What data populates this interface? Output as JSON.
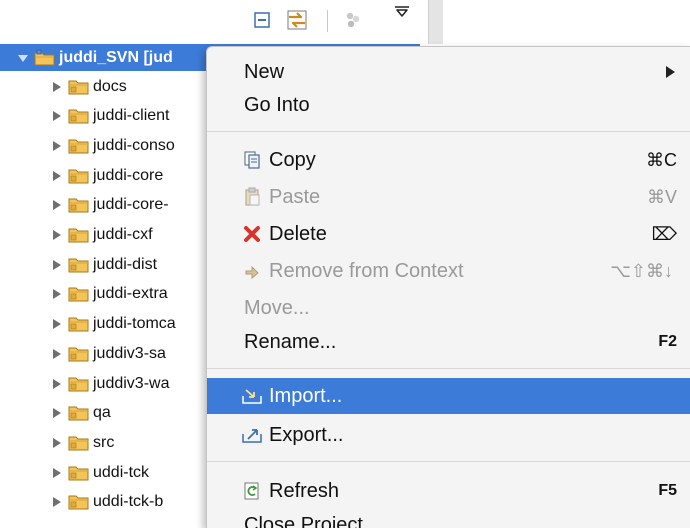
{
  "tree": {
    "root_label": "juddi_SVN [jud",
    "items": [
      {
        "label": "docs"
      },
      {
        "label": "juddi-client"
      },
      {
        "label": "juddi-conso"
      },
      {
        "label": "juddi-core"
      },
      {
        "label": "juddi-core-"
      },
      {
        "label": "juddi-cxf"
      },
      {
        "label": "juddi-dist"
      },
      {
        "label": "juddi-extra"
      },
      {
        "label": "juddi-tomca"
      },
      {
        "label": "juddiv3-sa"
      },
      {
        "label": "juddiv3-wa"
      },
      {
        "label": "qa"
      },
      {
        "label": "src"
      },
      {
        "label": "uddi-tck"
      },
      {
        "label": "uddi-tck-b"
      }
    ]
  },
  "menu": {
    "new": "New",
    "go_into": "Go Into",
    "copy": "Copy",
    "copy_accel": "⌘C",
    "paste": "Paste",
    "paste_accel": "⌘V",
    "delete": "Delete",
    "delete_accel": "⌦",
    "remove_context": "Remove from Context",
    "remove_context_accel": "⌥⇧⌘↓",
    "move": "Move...",
    "rename": "Rename...",
    "rename_accel": "F2",
    "import": "Import...",
    "export": "Export...",
    "refresh": "Refresh",
    "refresh_accel": "F5",
    "close_project": "Close Project"
  },
  "colors": {
    "selection": "#3d7bd8",
    "menu_bg": "#f4f4f4",
    "disabled_text": "#9a9a9a",
    "delete_icon": "#d9342b"
  },
  "icons": {
    "toolbar": [
      "collapse-all-icon",
      "link-with-editor-icon",
      "focus-icon",
      "view-menu-icon"
    ],
    "tree": [
      "twisty-icon",
      "project-folder-icon",
      "folder-icon"
    ],
    "menu": [
      "copy-icon",
      "paste-icon",
      "delete-icon",
      "remove-context-icon",
      "import-icon",
      "export-icon",
      "refresh-icon"
    ]
  }
}
